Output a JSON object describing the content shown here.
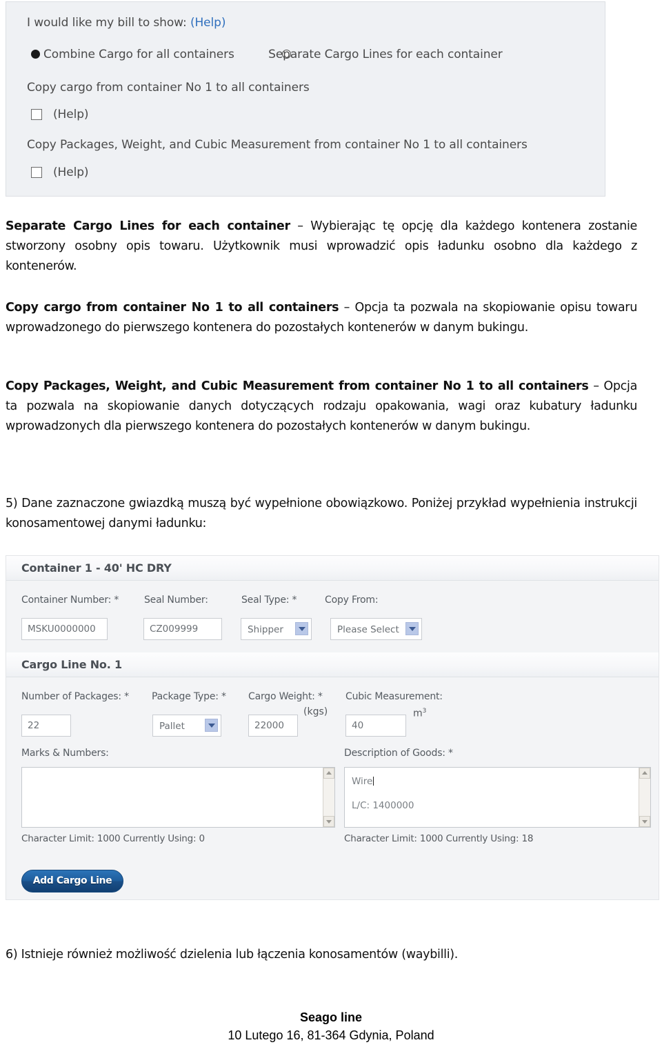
{
  "top_panel": {
    "intro_label": "I would like my bill to show:",
    "help_label": "(Help)",
    "radio_combine_label": "Combine Cargo for all containers",
    "radio_separate_label": "Separate Cargo Lines for each container",
    "copy_cargo_label": "Copy cargo from container No 1 to all containers",
    "copy_cargo_help": "(Help)",
    "copy_packages_label": "Copy Packages, Weight, and Cubic Measurement from container No 1 to all containers",
    "copy_packages_help": "(Help)",
    "radio_combine_checked": true,
    "radio_separate_checked": false,
    "checkbox_copy_cargo_checked": false,
    "checkbox_copy_packages_checked": false,
    "bg_color": "#eff1f4",
    "link_color": "#2f6fbd"
  },
  "paragraphs": {
    "p1_bold": "Separate Cargo Lines for each container",
    "p1_rest": " – Wybierając tę opcję dla każdego kontenera zostanie stworzony osobny opis towaru. Użytkownik musi wprowadzić opis ładunku osobno dla każdego z kontenerów.",
    "p2_bold": "Copy cargo from container No 1 to all containers",
    "p2_rest": " – Opcja ta pozwala na skopiowanie opisu towaru wprowadzonego do pierwszego kontenera do pozostałych kontenerów w danym bukingu.",
    "p3_bold": "Copy Packages, Weight, and Cubic Measurement from container No 1 to all containers",
    "p3_rest": " – Opcja ta pozwala na skopiowanie danych dotyczących rodzaju opakowania, wagi  oraz kubatury ładunku wprowadzonych dla pierwszego kontenera do pozostałych kontenerów w danym bukingu.",
    "p4": "5) Dane zaznaczone gwiazdką muszą być wypełnione obowiązkowo.  Poniżej przykład wypełnienia instrukcji konosamentowej danymi ładunku:",
    "p5": "6) Istnieje również możliwość dzielenia lub łączenia konosamentów (waybilli)."
  },
  "form": {
    "container_header": "Container 1 - 40' HC DRY",
    "cargo_line_header": "Cargo Line No. 1",
    "fields": {
      "container_number": {
        "label": "Container Number: *",
        "value": "MSKU0000000"
      },
      "seal_number": {
        "label": "Seal Number:",
        "value": "CZ009999"
      },
      "seal_type": {
        "label": "Seal Type: *",
        "value": "Shipper"
      },
      "copy_from": {
        "label": "Copy From:",
        "value": "Please Select"
      },
      "number_of_packages": {
        "label": "Number of Packages: *",
        "value": "22"
      },
      "package_type": {
        "label": "Package Type: *",
        "value": "Pallet"
      },
      "cargo_weight": {
        "label": "Cargo Weight: *",
        "value": "22000",
        "unit": "(kgs)"
      },
      "cubic_measurement": {
        "label": "Cubic Measurement:",
        "value": "40",
        "unit_base": "m",
        "unit_sup": "3"
      },
      "marks_numbers": {
        "label": "Marks & Numbers:",
        "value": "",
        "char_limit_text": "Character Limit: 1000 Currently Using: 0"
      },
      "description_of_goods": {
        "label": "Description of Goods: *",
        "line1": "Wire",
        "line2": "L/C: 1400000",
        "char_limit_text": "Character Limit: 1000 Currently Using: 18"
      }
    },
    "add_cargo_line_button": "Add Cargo Line",
    "button_color": "#1f5d9c",
    "panel_bg": "#f3f4f6"
  },
  "footer": {
    "company": "Seago line",
    "address": "10 Lutego 16, 81-364 Gdynia, Poland"
  }
}
